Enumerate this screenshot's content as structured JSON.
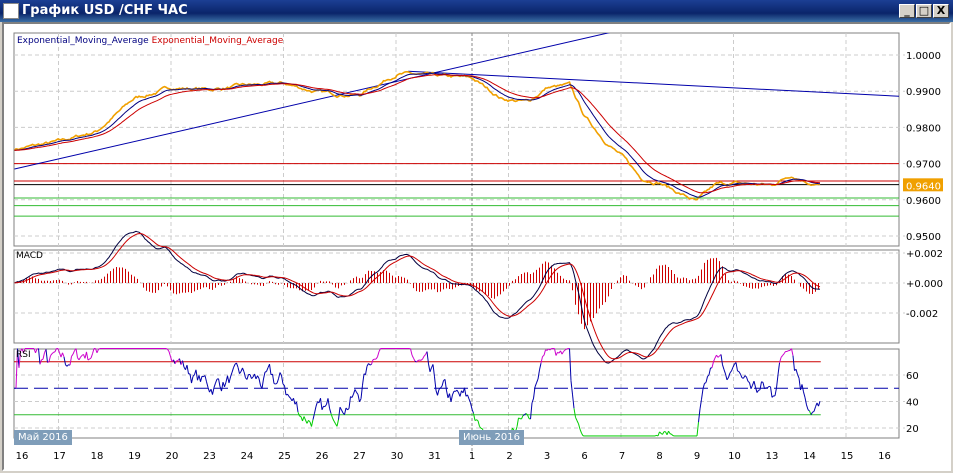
{
  "window": {
    "title": "График USD /CHF  ЧАС",
    "buttons": {
      "minimize": "_",
      "maximize": "□",
      "close": "X"
    }
  },
  "legend": {
    "ema_fast": "Exponential_Moving_Average",
    "ema_slow": "Exponential_Moving_Average"
  },
  "panels": {
    "macd": "MACD",
    "rsi": "RSI"
  },
  "month_labels": [
    "Май 2016",
    "Июнь 2016"
  ],
  "colors": {
    "price": "#f0a000",
    "ema_fast": "#000080",
    "ema_slow": "#cc0000",
    "resistance": "#cc0000",
    "support": "#33bb33",
    "current": "#000000",
    "trend": "#0000aa",
    "rsi_normal": "#0000aa",
    "rsi_over": "#cc00cc",
    "rsi_under": "#00cc00"
  },
  "chart_data": [
    {
      "type": "line",
      "title": "USD/CHF H1",
      "x_labels": [
        "16",
        "17",
        "18",
        "19",
        "20",
        "23",
        "24",
        "25",
        "26",
        "27",
        "30",
        "31",
        "1",
        "2",
        "3",
        "6",
        "7",
        "8",
        "9",
        "10",
        "13",
        "14",
        "15",
        "16"
      ],
      "y_ticks": [
        "1.0000",
        "0.9900",
        "0.9800",
        "0.9700",
        "0.9600",
        "0.9500"
      ],
      "ylim": [
        0.95,
        1.0
      ],
      "current_price": "0.9640",
      "price_keypoints": [
        [
          -0.2,
          0.974
        ],
        [
          1,
          0.976
        ],
        [
          2,
          0.979
        ],
        [
          3,
          0.988
        ],
        [
          4,
          0.991
        ],
        [
          5,
          0.9905
        ],
        [
          6,
          0.9915
        ],
        [
          7,
          0.992
        ],
        [
          8,
          0.9895
        ],
        [
          9,
          0.989
        ],
        [
          10,
          0.995
        ],
        [
          11,
          0.994
        ],
        [
          12,
          0.9935
        ],
        [
          12.8,
          0.988
        ],
        [
          13.5,
          0.987
        ],
        [
          14,
          0.991
        ],
        [
          14.6,
          0.9915
        ],
        [
          15,
          0.983
        ],
        [
          15.5,
          0.977
        ],
        [
          16,
          0.972
        ],
        [
          16.5,
          0.966
        ],
        [
          17,
          0.965
        ],
        [
          17.5,
          0.962
        ],
        [
          18,
          0.9595
        ],
        [
          18.5,
          0.964
        ],
        [
          19,
          0.9645
        ],
        [
          20,
          0.964
        ],
        [
          20.5,
          0.967
        ],
        [
          21,
          0.965
        ],
        [
          21.3,
          0.964
        ]
      ],
      "horizontal_levels": {
        "resistance": [
          0.97,
          0.9652
        ],
        "current": 0.9642,
        "support": [
          0.9605,
          0.9584,
          0.9555
        ]
      },
      "trendlines": [
        [
          [
            -0.2,
            0.9685
          ],
          [
            15.8,
            1.0065
          ]
        ],
        [
          [
            10.3,
            0.9955
          ],
          [
            23.6,
            0.9885
          ]
        ]
      ]
    },
    {
      "type": "line",
      "title": "MACD",
      "y_ticks": [
        "+0.002",
        "+0.000",
        "-0.002"
      ],
      "ylim": [
        -0.0037,
        0.0025
      ]
    },
    {
      "type": "line",
      "title": "RSI",
      "y_ticks": [
        "60",
        "40",
        "20"
      ],
      "levels": [
        70,
        50,
        30
      ],
      "ylim": [
        12,
        82
      ]
    }
  ]
}
